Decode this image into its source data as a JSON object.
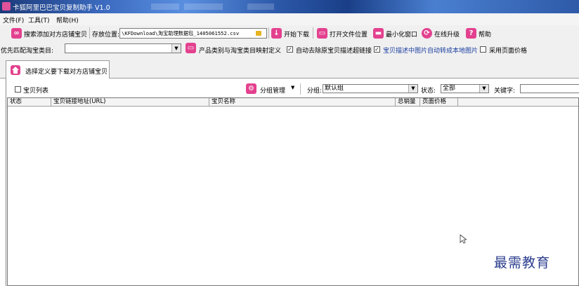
{
  "window": {
    "title": "卡狐阿里巴巴宝贝复制助手 V1.0"
  },
  "menu": {
    "items": [
      "文件(F)",
      "工具(T)",
      "帮助(H)"
    ]
  },
  "toolbar1": {
    "search_add_label": "搜索添加对方店铺宝贝",
    "save_location_label": "存放位置:",
    "save_path_value": "\\KFDownload\\淘宝助理数据包_1405061552.csv",
    "start_download_label": "开始下载",
    "open_file_location_label": "打开文件位置",
    "minimize_label": "最小化窗口",
    "online_upgrade_label": "在线升级",
    "help_label": "帮助"
  },
  "toolbar2": {
    "priority_category_label": "优先匹配淘宝类目:",
    "category_value": "",
    "mapping_label": "产品类别与淘宝类目映射定义",
    "options": [
      {
        "label": "自动去除原宝贝描述超链接",
        "checked": true
      },
      {
        "label": "宝贝描述中图片自动转成本地图片",
        "checked": true
      },
      {
        "label": "采用页面价格",
        "checked": false
      }
    ]
  },
  "tab": {
    "label": "选择定义要下载对方店铺宝贝"
  },
  "filters": {
    "item_list_label": "宝贝列表",
    "item_list_checked": false,
    "group_manage_label": "分组管理",
    "group_label": "分组:",
    "group_value": "默认组",
    "status_label": "状态:",
    "status_value": "全部",
    "keyword_label": "关键字:",
    "keyword_value": ""
  },
  "table": {
    "columns": [
      "状态",
      "宝贝链接地址(URL)",
      "宝贝名称",
      "总销量",
      "页面价格"
    ],
    "rows": []
  },
  "watermark": "最需教育",
  "colors": {
    "accent": "#e3418f",
    "titlebar": "#2c58a8",
    "watermark": "#2b3d8e"
  }
}
